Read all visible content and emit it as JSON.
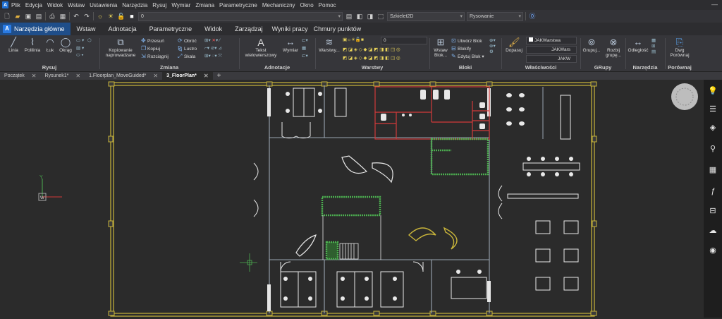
{
  "app": {
    "logo_letter": "A",
    "menu": [
      "Plik",
      "Edycja",
      "Widok",
      "Wstaw",
      "Ustawienia",
      "Narzędzia",
      "Rysuj",
      "Wymiar",
      "Zmiana",
      "Parametryczne",
      "Mechaniczny",
      "Okno",
      "Pomoc"
    ]
  },
  "quick_access": {
    "layer_value": "0",
    "visual_style": "Szkielet2D",
    "workspace": "Rysowanie"
  },
  "ribbon_tabs": [
    "Narzędzia główne",
    "Wstaw",
    "Adnotacja",
    "Parametryczne",
    "Widok",
    "Zarządzaj",
    "Wyniki pracy",
    "Chmury punktów"
  ],
  "ribbon": {
    "rysuj": {
      "label": "Rysuj",
      "linia": "Linia",
      "polilinia": "Polilinia",
      "luk": "Łuk",
      "okrag": "Okrąg"
    },
    "zmiana": {
      "label": "Zmiana",
      "kopiowanie": "Kopiowanie",
      "kopiowanie2": "naprowadzane",
      "przesun": "Przesuń",
      "kopiuj": "Kopiuj",
      "rozciagnij": "Rozciągnij",
      "obroc": "Obróć",
      "lustro": "Lustro",
      "skala": "Skala"
    },
    "adnotacje": {
      "label": "Adnotacje",
      "tekst": "Tekst",
      "tekst2": "wielowierszowy",
      "wymiar": "Wymiar"
    },
    "warstwy": {
      "label": "Warstwy",
      "warstwy_btn": "Warstwy...",
      "layer_value": "0"
    },
    "bloki": {
      "label": "Bloki",
      "wstaw": "Wstaw",
      "blok": "Blok...",
      "utworz": "Utwórz Blok",
      "blokify": "Blokify",
      "edytuj": "Edytuj Blok"
    },
    "wlasciwosci": {
      "label": "Właściwości",
      "dopasuj": "Dopasuj",
      "jak1": "JAKWarstwa",
      "jak2": "JAKWars",
      "jak3": "JAKW"
    },
    "grupy": {
      "label": "GRupy",
      "grupuj": "Grupuj...",
      "rozbij": "Rozbij",
      "rozbij2": "grupę..."
    },
    "narzedzia": {
      "label": "Narzędzia",
      "odleglosc": "Odległość"
    },
    "porownaj": {
      "label": "Porównaj",
      "dwg": "Dwg",
      "porownaj": "Porównaj"
    }
  },
  "doc_tabs": [
    "Początek",
    "Rysunek1*",
    "1.Floorplan_MoveGuided*",
    "3_FloorPlan*",
    "+"
  ],
  "sidebar_icons": [
    "lightbulb-icon",
    "sliders-icon",
    "layers-icon",
    "paperclip-icon",
    "grid-icon",
    "function-icon",
    "tree-icon",
    "cloud-icon",
    "balloon-icon"
  ],
  "ucs": {
    "y": "Y",
    "w": "W"
  },
  "colors": {
    "accent": "#1f4e8a",
    "wall": "#b8c2cc",
    "yellow": "#c9b53a",
    "red": "#d23a3a",
    "green": "#4caf50",
    "white": "#e8e8e8"
  }
}
